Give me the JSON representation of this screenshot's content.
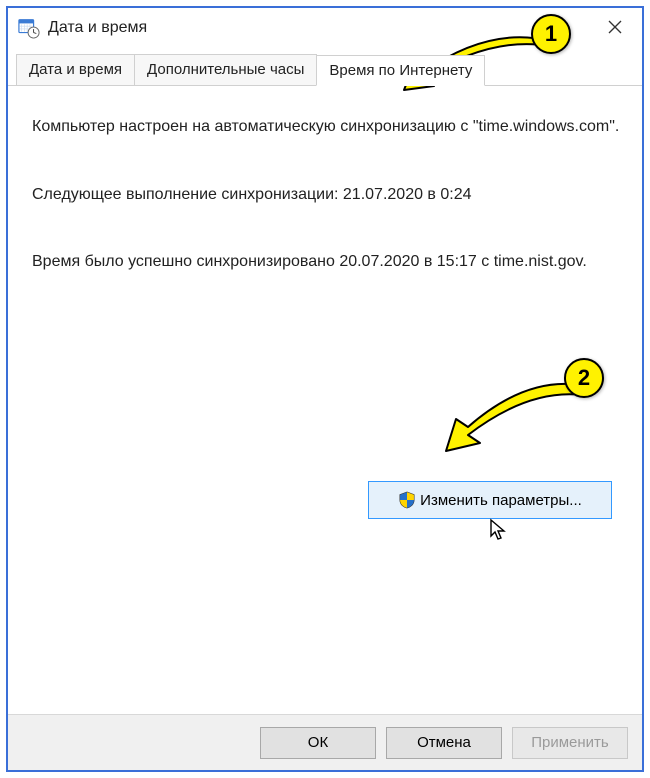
{
  "window": {
    "title": "Дата и время"
  },
  "tabs": [
    {
      "label": "Дата и время",
      "active": false
    },
    {
      "label": "Дополнительные часы",
      "active": false
    },
    {
      "label": "Время по Интернету",
      "active": true
    }
  ],
  "content": {
    "para1": "Компьютер настроен на автоматическую синхронизацию с \"time.windows.com\".",
    "para2": "Следующее выполнение синхронизации: 21.07.2020 в 0:24",
    "para3": "Время было успешно синхронизировано 20.07.2020 в 15:17 с time.nist.gov.",
    "change_button": "Изменить параметры..."
  },
  "buttons": {
    "ok": "ОК",
    "cancel": "Отмена",
    "apply": "Применить"
  },
  "callouts": {
    "n1": "1",
    "n2": "2"
  }
}
